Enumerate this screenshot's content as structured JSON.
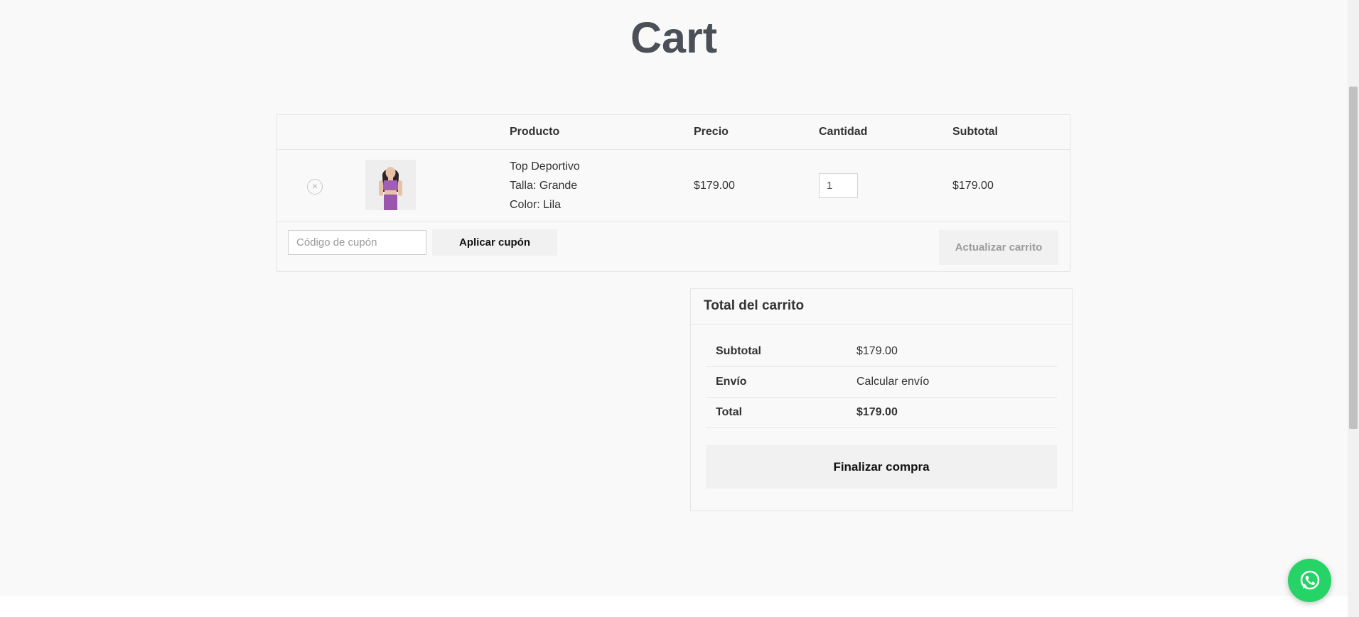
{
  "page": {
    "title": "Cart"
  },
  "cart": {
    "headers": {
      "product": "Producto",
      "price": "Precio",
      "quantity": "Cantidad",
      "subtotal": "Subtotal"
    },
    "items": [
      {
        "remove_icon": "×",
        "name": "Top Deportivo",
        "size_label": "Talla:",
        "size": "Grande",
        "color_label": "Color:",
        "color": "Lila",
        "price": "$179.00",
        "quantity": "1",
        "subtotal": "$179.00"
      }
    ],
    "coupon": {
      "placeholder": "Código de cupón",
      "apply_label": "Aplicar cupón"
    },
    "update_label": "Actualizar carrito"
  },
  "totals": {
    "title": "Total del carrito",
    "rows": [
      {
        "label": "Subtotal",
        "value": "$179.00"
      },
      {
        "label": "Envío",
        "value": "Calcular envío"
      },
      {
        "label": "Total",
        "value": "$179.00"
      }
    ],
    "checkout_label": "Finalizar compra"
  },
  "colors": {
    "title": "#4b4f58",
    "whatsapp": "#25d366",
    "product_purple": "#a05fb3"
  },
  "icons": {
    "remove": "close-circle-icon",
    "whatsapp": "whatsapp-icon"
  }
}
